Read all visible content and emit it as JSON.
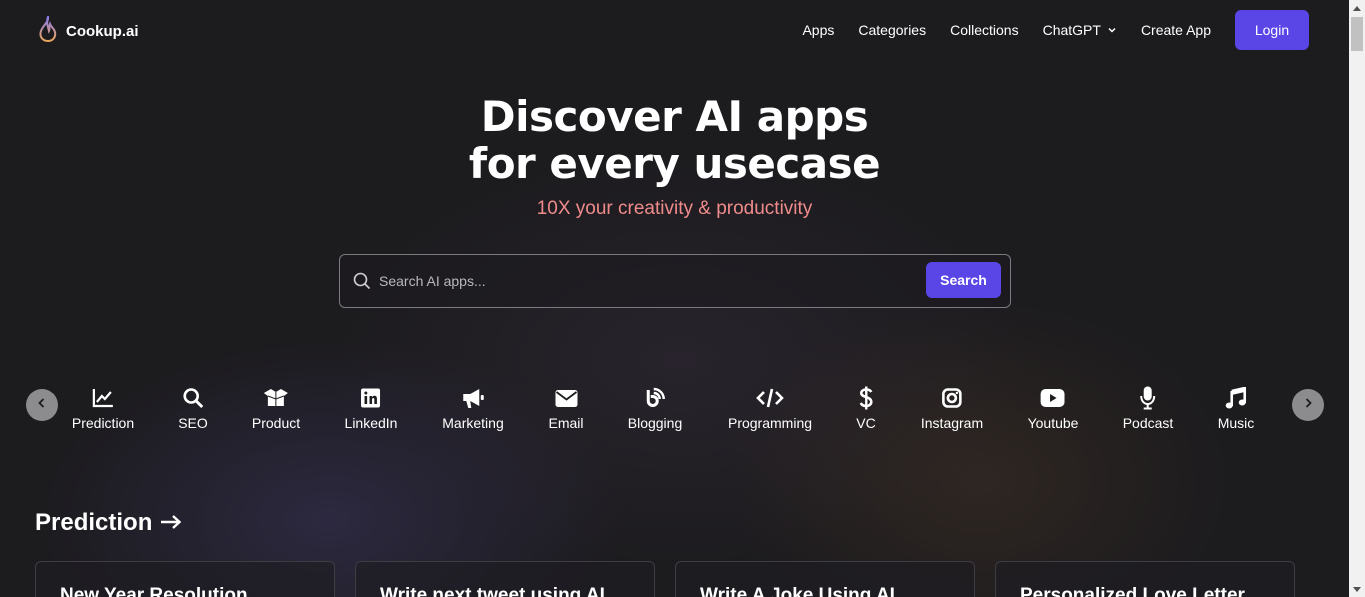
{
  "header": {
    "logo_text": "Cookup.ai",
    "nav": [
      {
        "label": "Apps"
      },
      {
        "label": "Categories"
      },
      {
        "label": "Collections"
      },
      {
        "label": "ChatGPT"
      },
      {
        "label": "Create App"
      }
    ],
    "login_label": "Login"
  },
  "hero": {
    "title_line1": "Discover AI apps",
    "title_line2": "for every usecase",
    "subtitle": "10X your creativity & productivity"
  },
  "search": {
    "placeholder": "Search AI apps...",
    "value": "",
    "button_label": "Search"
  },
  "categories": [
    {
      "label": "Prediction",
      "icon": "chart-line-icon"
    },
    {
      "label": "SEO",
      "icon": "search-icon"
    },
    {
      "label": "Product",
      "icon": "box-open-icon"
    },
    {
      "label": "LinkedIn",
      "icon": "linkedin-icon"
    },
    {
      "label": "Marketing",
      "icon": "bullhorn-icon"
    },
    {
      "label": "Email",
      "icon": "envelope-icon"
    },
    {
      "label": "Blogging",
      "icon": "blog-icon"
    },
    {
      "label": "Programming",
      "icon": "code-icon"
    },
    {
      "label": "VC",
      "icon": "dollar-icon"
    },
    {
      "label": "Instagram",
      "icon": "instagram-icon"
    },
    {
      "label": "Youtube",
      "icon": "youtube-icon"
    },
    {
      "label": "Podcast",
      "icon": "microphone-icon"
    },
    {
      "label": "Music",
      "icon": "music-icon"
    }
  ],
  "section": {
    "title": "Prediction",
    "arrow": "→",
    "cards": [
      {
        "title": "New Year Resolution"
      },
      {
        "title": "Write next tweet using AI"
      },
      {
        "title": "Write A Joke Using AI"
      },
      {
        "title": "Personalized Love Letter"
      }
    ]
  },
  "colors": {
    "accent": "#5a45e6",
    "subtitle": "#f08b8b",
    "background": "#1c1b1e"
  }
}
